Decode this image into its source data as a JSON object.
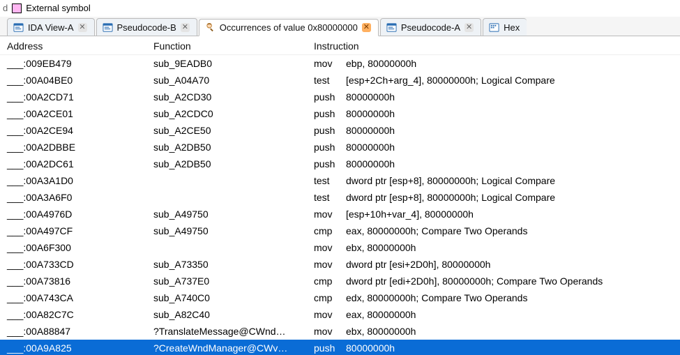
{
  "legend": {
    "label": "External symbol",
    "color": "#ffb6f2",
    "prefix": "d"
  },
  "tabs": [
    {
      "label": "IDA View-A",
      "icon": "ida",
      "active": false
    },
    {
      "label": "Pseudocode-B",
      "icon": "pc",
      "active": false
    },
    {
      "label": "Occurrences of value 0x80000000",
      "icon": "find",
      "active": true
    },
    {
      "label": "Pseudocode-A",
      "icon": "pc",
      "active": false
    },
    {
      "label": "Hex",
      "icon": "hex",
      "active": false
    }
  ],
  "columns": {
    "address": "Address",
    "function": "Function",
    "instruction": "Instruction"
  },
  "rows": [
    {
      "addr": ":009EB479",
      "func": "sub_9EADB0",
      "mn": "mov",
      "ops": "ebp, 80000000h",
      "sel": false
    },
    {
      "addr": ":00A04BE0",
      "func": "sub_A04A70",
      "mn": "test",
      "ops": "[esp+2Ch+arg_4], 80000000h; Logical Compare",
      "sel": false
    },
    {
      "addr": ":00A2CD71",
      "func": "sub_A2CD30",
      "mn": "push",
      "ops": "80000000h",
      "sel": false
    },
    {
      "addr": ":00A2CE01",
      "func": "sub_A2CDC0",
      "mn": "push",
      "ops": "80000000h",
      "sel": false
    },
    {
      "addr": ":00A2CE94",
      "func": "sub_A2CE50",
      "mn": "push",
      "ops": "80000000h",
      "sel": false
    },
    {
      "addr": ":00A2DBBE",
      "func": "sub_A2DB50",
      "mn": "push",
      "ops": "80000000h",
      "sel": false
    },
    {
      "addr": ":00A2DC61",
      "func": "sub_A2DB50",
      "mn": "push",
      "ops": "80000000h",
      "sel": false
    },
    {
      "addr": ":00A3A1D0",
      "func": "",
      "mn": "test",
      "ops": "dword ptr [esp+8], 80000000h; Logical Compare",
      "sel": false
    },
    {
      "addr": ":00A3A6F0",
      "func": "",
      "mn": "test",
      "ops": "dword ptr [esp+8], 80000000h; Logical Compare",
      "sel": false
    },
    {
      "addr": ":00A4976D",
      "func": "sub_A49750",
      "mn": "mov",
      "ops": "[esp+10h+var_4], 80000000h",
      "sel": false
    },
    {
      "addr": ":00A497CF",
      "func": "sub_A49750",
      "mn": "cmp",
      "ops": "eax, 80000000h; Compare Two Operands",
      "sel": false
    },
    {
      "addr": ":00A6F300",
      "func": "",
      "mn": "mov",
      "ops": "ebx, 80000000h",
      "sel": false
    },
    {
      "addr": ":00A733CD",
      "func": "sub_A73350",
      "mn": "mov",
      "ops": "dword ptr [esi+2D0h], 80000000h",
      "sel": false
    },
    {
      "addr": ":00A73816",
      "func": "sub_A737E0",
      "mn": "cmp",
      "ops": "dword ptr [edi+2D0h], 80000000h; Compare Two Operands",
      "sel": false
    },
    {
      "addr": ":00A743CA",
      "func": "sub_A740C0",
      "mn": "cmp",
      "ops": "edx, 80000000h; Compare Two Operands",
      "sel": false
    },
    {
      "addr": ":00A82C7C",
      "func": "sub_A82C40",
      "mn": "mov",
      "ops": "eax, 80000000h",
      "sel": false
    },
    {
      "addr": ":00A88847",
      "func": "?TranslateMessage@CWnd…",
      "mn": "mov",
      "ops": "ebx, 80000000h",
      "sel": false
    },
    {
      "addr": ":00A9A825",
      "func": "?CreateWndManager@CWv…",
      "mn": "push",
      "ops": "80000000h",
      "sel": true
    }
  ]
}
